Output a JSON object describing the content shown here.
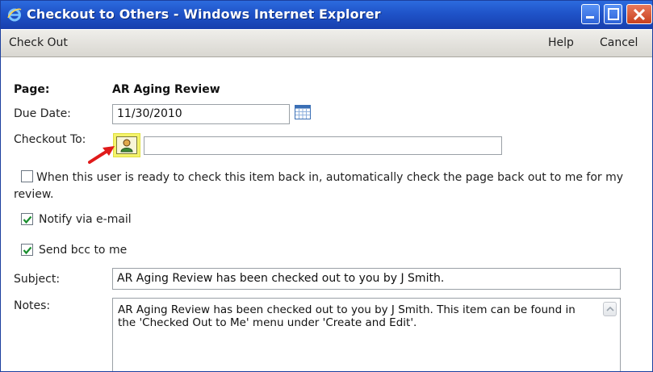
{
  "window": {
    "title": "Checkout to Others - Windows Internet Explorer",
    "icons": [
      "ie-icon",
      "minimize-icon",
      "maximize-icon",
      "close-icon"
    ]
  },
  "menubar": {
    "check_out": "Check Out",
    "help": "Help",
    "cancel": "Cancel"
  },
  "form": {
    "page_label": "Page:",
    "page_value": "AR Aging Review",
    "due_date_label": "Due Date:",
    "due_date_value": "11/30/2010",
    "checkout_to_label": "Checkout To:",
    "checkout_to_value": "",
    "auto_checkout_text": "When this user is ready to check this item back in, automatically check the page back out to me for my review.",
    "auto_checkout_checked": false,
    "notify_text": "Notify via e-mail",
    "notify_checked": true,
    "bcc_text": "Send bcc to me",
    "bcc_checked": true,
    "subject_label": "Subject:",
    "subject_value": "AR Aging Review has been checked out to you by J Smith.",
    "notes_label": "Notes:",
    "notes_value": "AR Aging Review has been checked out to you by J Smith.  This item can be found in the 'Checked Out to Me' menu under 'Create and Edit'."
  },
  "colors": {
    "titlebar": "#1f53c8",
    "highlight": "#f4f36a",
    "arrow": "#e01a1a",
    "check": "#1a8f2e"
  }
}
